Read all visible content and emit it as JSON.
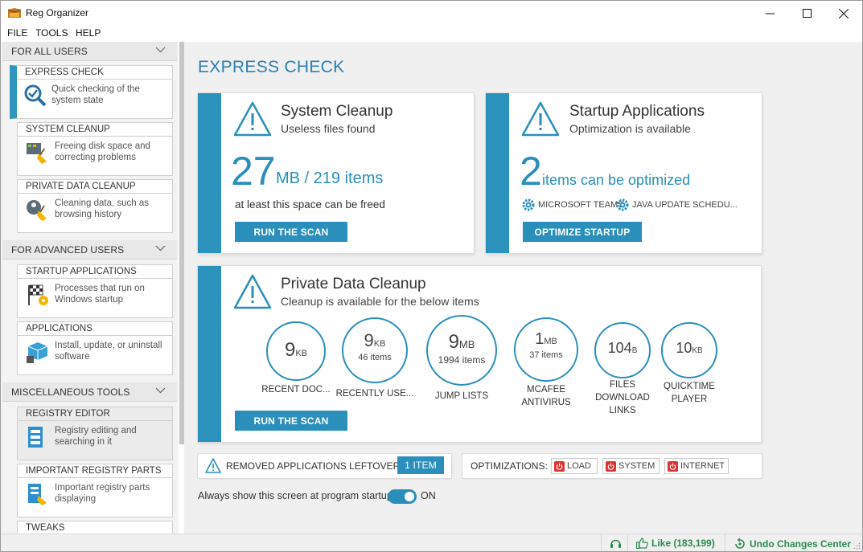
{
  "window": {
    "title": "Reg Organizer"
  },
  "menu": [
    "FILE",
    "TOOLS",
    "HELP"
  ],
  "sidebar": {
    "sections": [
      {
        "label": "FOR ALL USERS"
      },
      {
        "label": "FOR ADVANCED USERS"
      },
      {
        "label": "MISCELLANEOUS TOOLS"
      }
    ],
    "items": [
      {
        "title": "EXPRESS CHECK",
        "desc": "Quick checking of the system state",
        "icon": "magnifier-check-icon"
      },
      {
        "title": "SYSTEM CLEANUP",
        "desc": "Freeing disk space and correcting problems",
        "icon": "broom-monitor-icon"
      },
      {
        "title": "PRIVATE DATA CLEANUP",
        "desc": "Cleaning data, such as browsing history",
        "icon": "broom-user-icon"
      },
      {
        "title": "STARTUP APPLICATIONS",
        "desc": "Processes that run on Windows startup",
        "icon": "racing-flag-gear-icon"
      },
      {
        "title": "APPLICATIONS",
        "desc": "Install, update, or uninstall software",
        "icon": "box-trash-icon"
      },
      {
        "title": "REGISTRY EDITOR",
        "desc": "Registry editing and searching in it",
        "icon": "registry-editor-icon"
      },
      {
        "title": "IMPORTANT REGISTRY PARTS",
        "desc": "Important registry parts displaying",
        "icon": "registry-broom-icon"
      },
      {
        "title": "TWEAKS",
        "desc": "",
        "icon": ""
      }
    ]
  },
  "main": {
    "heading": "EXPRESS CHECK",
    "system_cleanup": {
      "title": "System Cleanup",
      "subtitle": "Useless files found",
      "big": "27",
      "unit": "MB / 219 items",
      "note": "at least this space can be freed",
      "button": "RUN THE SCAN"
    },
    "startup": {
      "title": "Startup Applications",
      "subtitle": "Optimization is available",
      "big": "2",
      "unit": "items can be optimized",
      "tags": [
        "MICROSOFT TEAMS",
        "JAVA UPDATE SCHEDU..."
      ],
      "button": "OPTIMIZE STARTUP"
    },
    "private": {
      "title": "Private Data Cleanup",
      "subtitle": "Cleanup is available for the below items",
      "button": "RUN THE SCAN",
      "items": [
        {
          "num": "9",
          "unit": "KB",
          "count": "",
          "label": "RECENT DOC..."
        },
        {
          "num": "9",
          "unit": "KB",
          "count": "46 items",
          "label": "RECENTLY USE..."
        },
        {
          "num": "9",
          "unit": "MB",
          "count": "1994 items",
          "label": "JUMP LISTS"
        },
        {
          "num": "1",
          "unit": "MB",
          "count": "37 items",
          "label": "MCAFEE ANTIVIRUS"
        },
        {
          "num": "104",
          "unit": "B",
          "count": "",
          "label": "FILES DOWNLOAD LINKS"
        },
        {
          "num": "10",
          "unit": "KB",
          "count": "",
          "label": "QUICKTIME PLAYER"
        }
      ]
    },
    "leftovers": {
      "label": "REMOVED APPLICATIONS LEFTOVERS",
      "badge": "1 ITEM"
    },
    "optimizations": {
      "label": "OPTIMIZATIONS:",
      "items": [
        "LOAD",
        "SYSTEM",
        "INTERNET"
      ]
    },
    "startup_toggle": {
      "label": "Always show this screen at program startup",
      "state": "ON"
    }
  },
  "status": {
    "like": "Like (183,199)",
    "undo": "Undo Changes Center"
  },
  "colors": {
    "accent": "#2b93bb",
    "status_green": "#2e8b4c",
    "off_red": "#d33"
  }
}
